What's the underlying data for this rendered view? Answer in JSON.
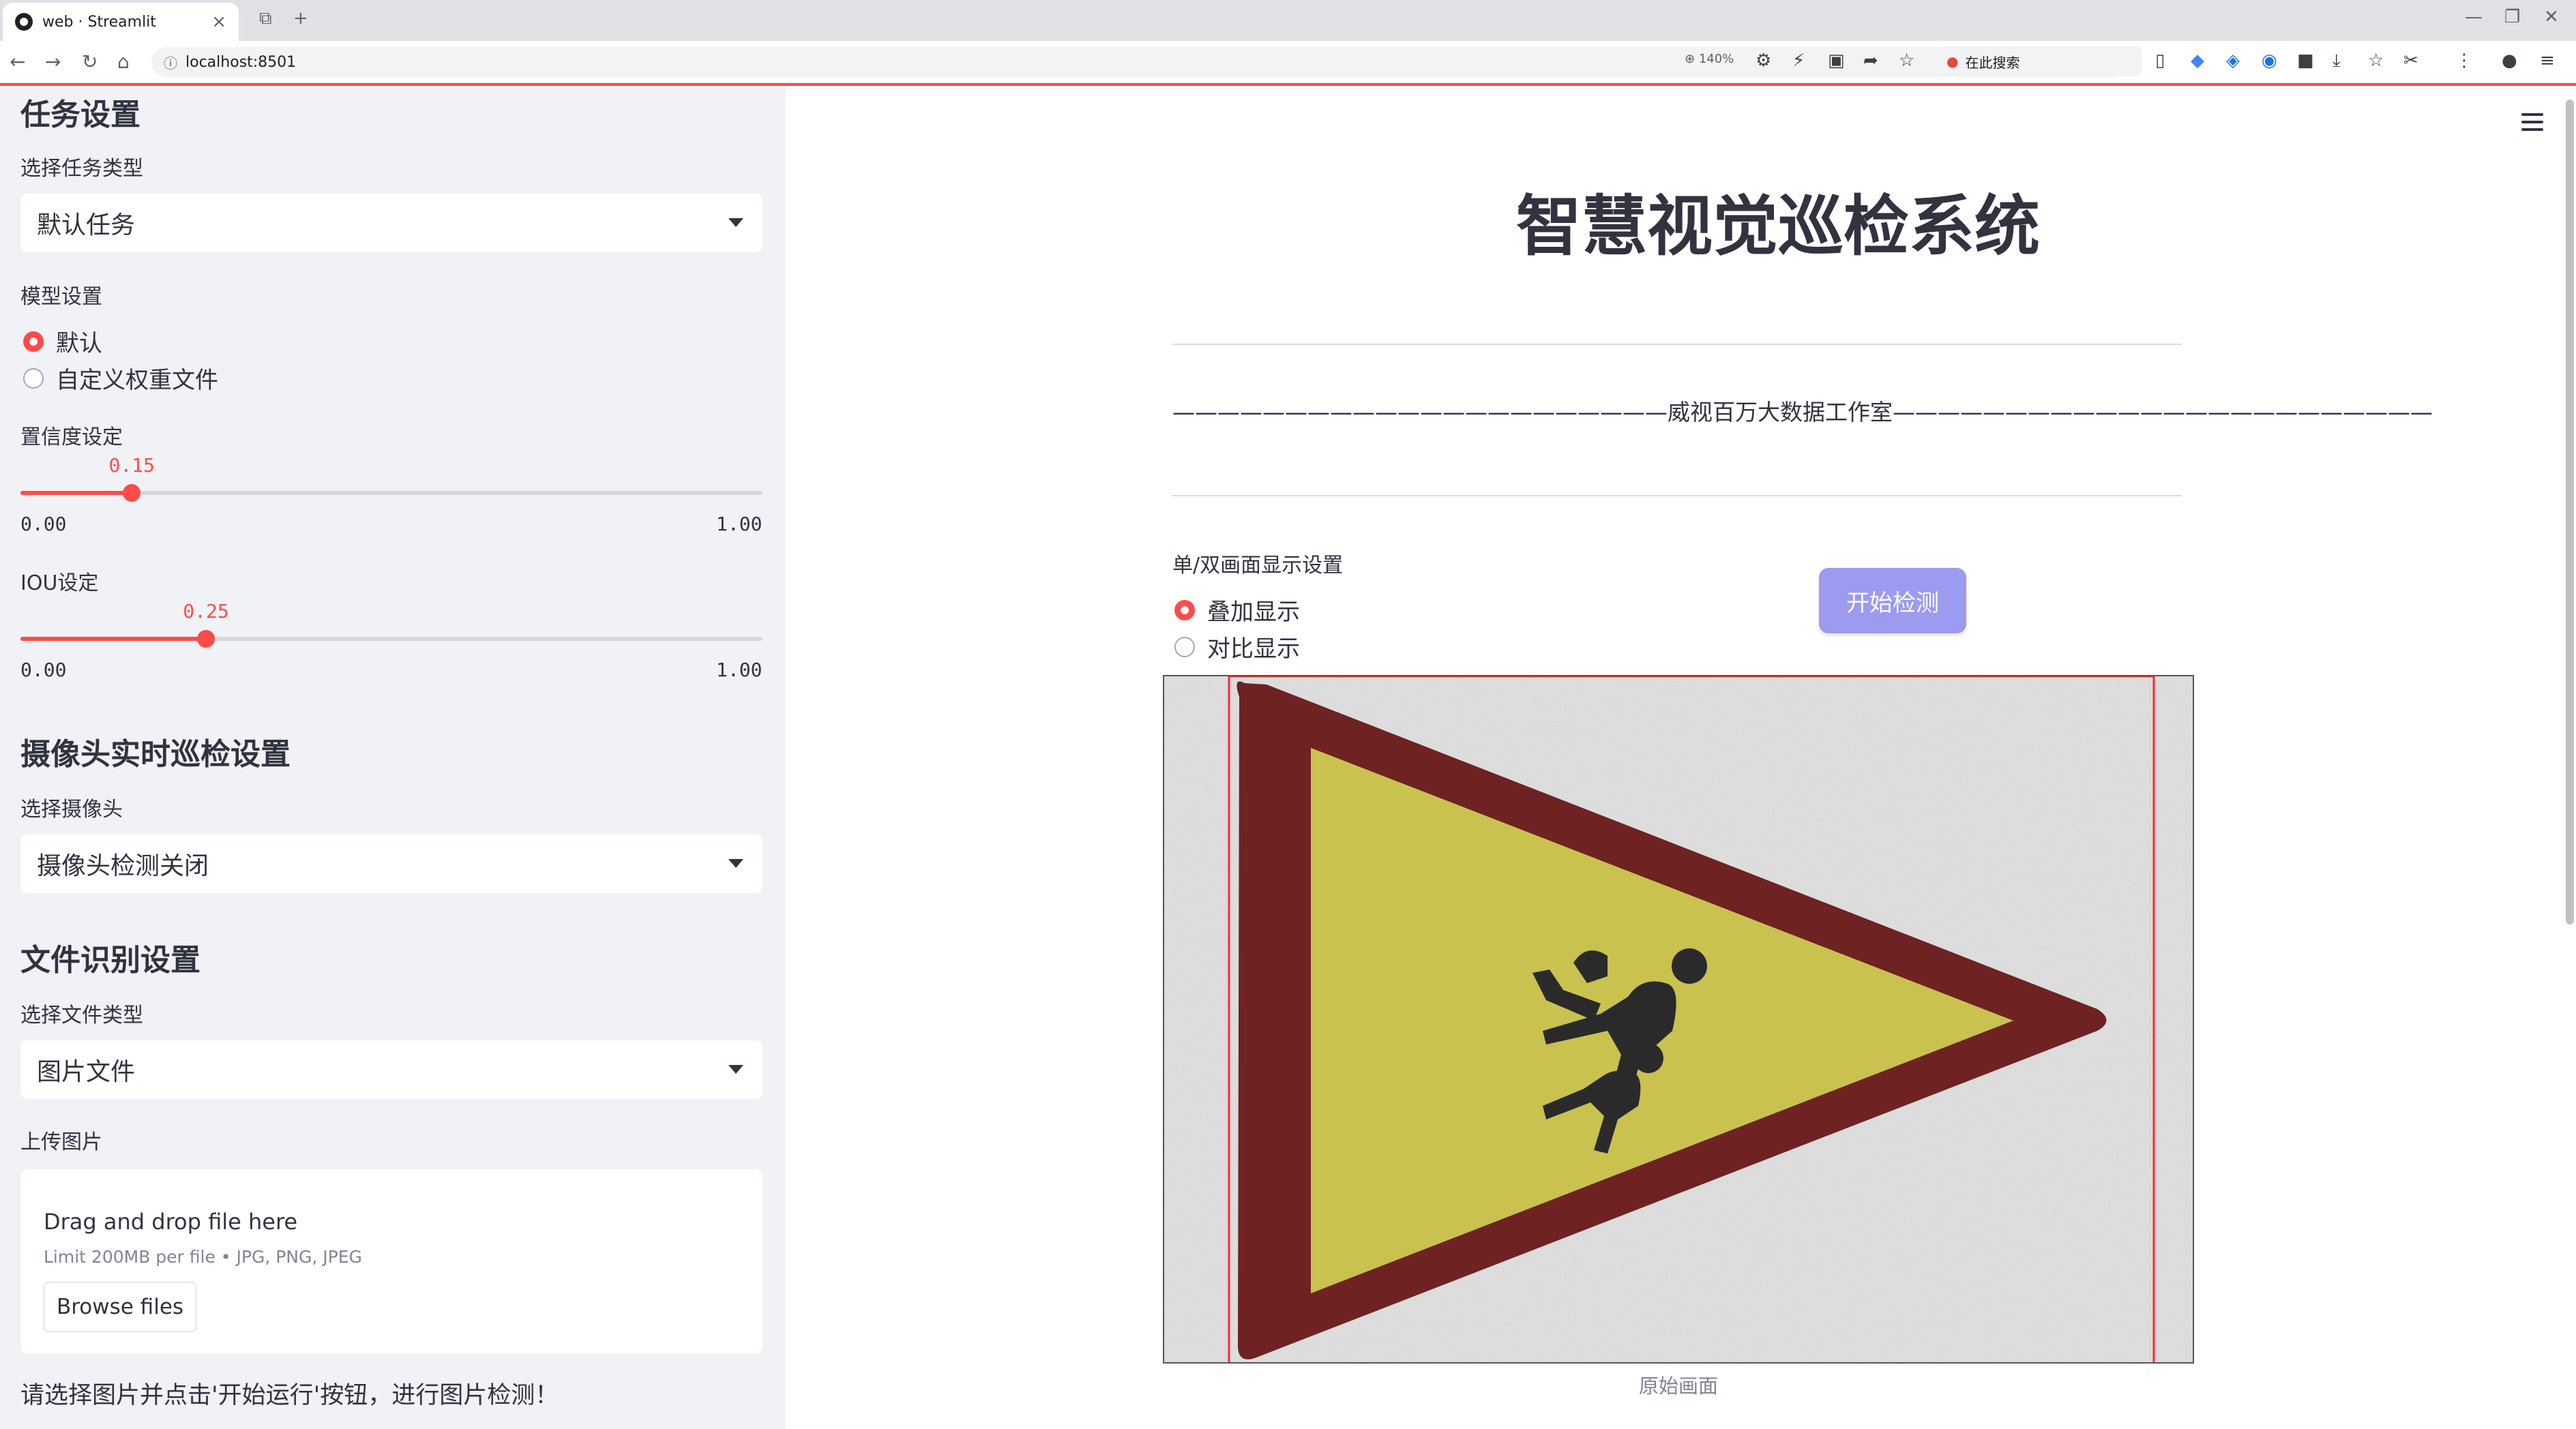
{
  "browser": {
    "tab_title": "web · Streamlit",
    "url": "localhost:8501",
    "zoom": "140%",
    "search_label": "在此搜索"
  },
  "sidebar": {
    "task_section_title": "任务设置",
    "task_type_label": "选择任务类型",
    "task_type_value": "默认任务",
    "model_section_label": "模型设置",
    "model_options": [
      "默认",
      "自定义权重文件"
    ],
    "model_selected": "默认",
    "confidence": {
      "label": "置信度设定",
      "value": "0.15",
      "value_num": 0.15,
      "min": "0.00",
      "max": "1.00"
    },
    "iou": {
      "label": "IOU设定",
      "value": "0.25",
      "value_num": 0.25,
      "min": "0.00",
      "max": "1.00"
    },
    "camera_section_title": "摄像头实时巡检设置",
    "camera_label": "选择摄像头",
    "camera_value": "摄像头检测关闭",
    "file_section_title": "文件识别设置",
    "file_type_label": "选择文件类型",
    "file_type_value": "图片文件",
    "upload_label": "上传图片",
    "upload": {
      "drag_text": "Drag and drop file here",
      "limit_text": "Limit 200MB per file • JPG, PNG, JPEG",
      "browse_label": "Browse files"
    },
    "note": "请选择图片并点击'开始运行'按钮，进行图片检测！"
  },
  "main": {
    "title": "智慧视觉巡检系统",
    "subtitle": "——————————————————————威视百万大数据工作室————————————————————————",
    "display_label": "单/双画面显示设置",
    "display_options": [
      "叠加显示",
      "对比显示"
    ],
    "display_selected": "叠加显示",
    "start_button": "开始检测",
    "image_caption": "原始画面"
  },
  "colors": {
    "accent": "#ff4b4b",
    "sidebar_bg": "#f0f2f6",
    "button_bg": "#9c9bef",
    "sign_border": "#6e2222",
    "sign_fill": "#c9c24e"
  }
}
